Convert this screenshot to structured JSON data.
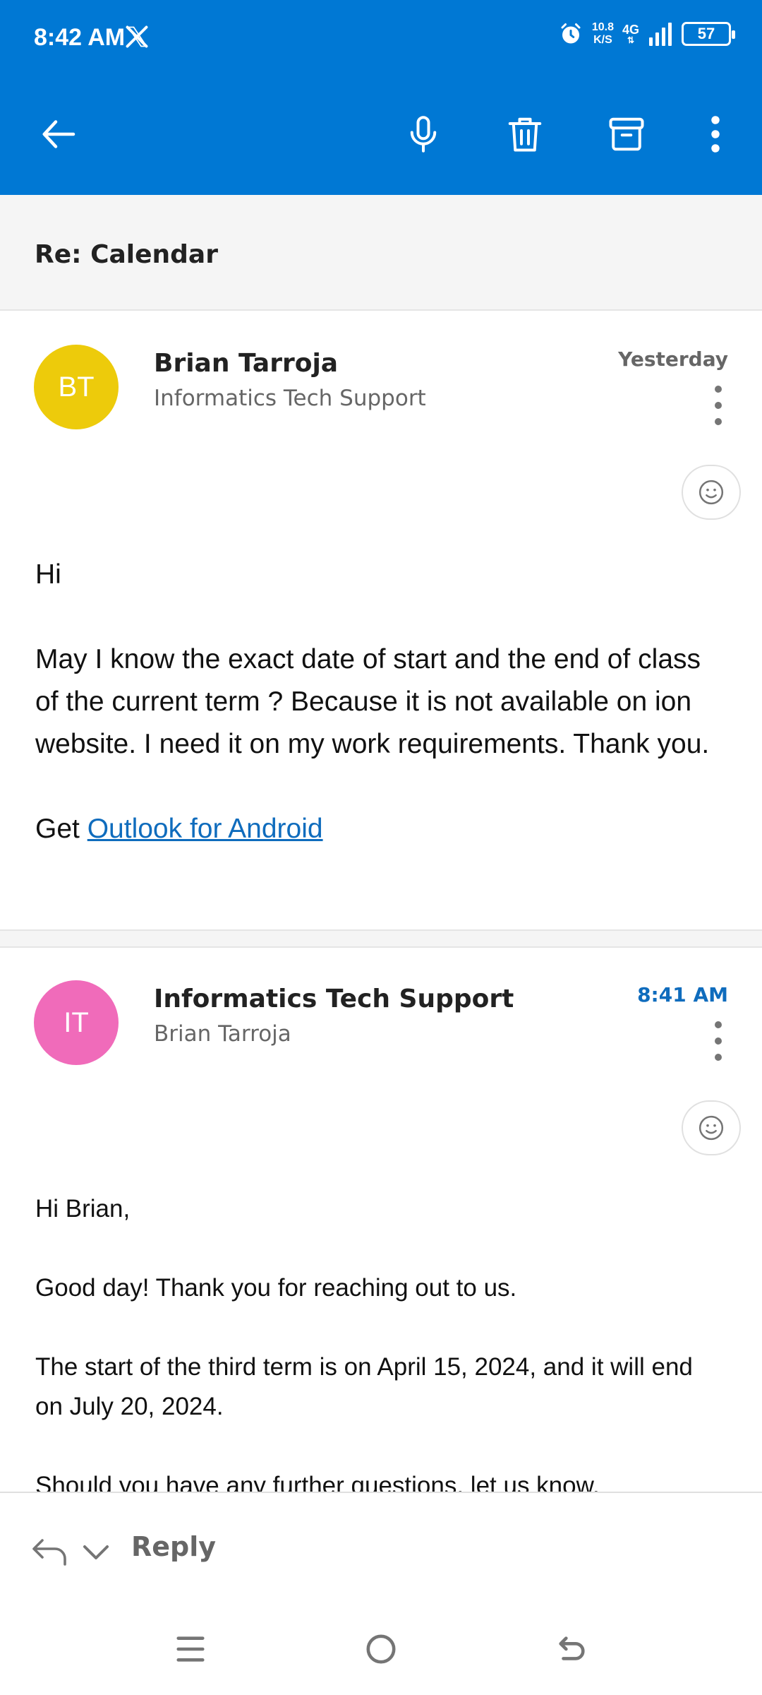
{
  "status_bar": {
    "time": "8:42 AM",
    "net_speed_value": "10.8",
    "net_speed_unit": "K/S",
    "network": "4G",
    "battery": "57"
  },
  "toolbar": {
    "back_icon": "arrow-left-icon",
    "mic_icon": "microphone-icon",
    "delete_icon": "trash-icon",
    "archive_icon": "archive-icon",
    "more_icon": "more-vertical-icon"
  },
  "subject": "Re: Calendar",
  "messages": [
    {
      "avatar_initials": "BT",
      "avatar_color": "#EDCB0B",
      "sender": "Brian Tarroja",
      "recipient": "Informatics Tech Support",
      "date": "Yesterday",
      "paragraphs": [
        "Hi",
        "May I know the exact date of  start and the end of class of the current term ? Because it is not available on ion website. I need it on my work requirements. Thank you."
      ],
      "signature_prefix": "Get ",
      "signature_link": "Outlook for Android"
    },
    {
      "avatar_initials": "IT",
      "avatar_color": "#F06BBA",
      "sender": "Informatics Tech Support",
      "recipient": "Brian Tarroja",
      "date": "8:41 AM",
      "paragraphs": [
        "Hi Brian,",
        "Good day! Thank you for reaching out to us.",
        "The start of the third term is on April 15, 2024, and it will end on July 20, 2024.",
        "Should you have any further questions, let us know."
      ]
    }
  ],
  "reply_bar": {
    "label": "Reply"
  },
  "colors": {
    "accent": "#0078D4",
    "link": "#0F6CBD"
  }
}
